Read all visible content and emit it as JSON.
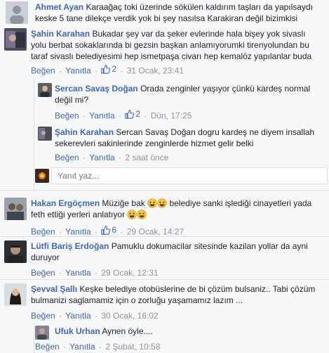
{
  "comments": [
    {
      "name": "Ahmet Ayan",
      "text": "Karaağaç toki üzerinde sökülen kaldırım taşları da yapılsaydı keske 5 tane dilekçe verdik yok bi şey nasılsa Karakiran değil bizimkisi"
    },
    {
      "name": "Şahin Karahan",
      "text": "Bukadar şey var da şeker evlerinde hala bişey yok sivaslı yolu berbat sokaklarında bi gezsin başkan anlamıyorumki tirenyolundan bu taraf sivaslı belediyesimi hep ismetpaşa civarı hep kemalöz yapılanlar buda",
      "like": "Beğen",
      "reply": "Yanıtla",
      "likes": "2",
      "time": "31 Ocak, 23:41"
    },
    {
      "name": "Sercan Savaş Doğan",
      "text": "Orada zenginler yaşıyor çünkü kardeş normal değil mi?",
      "like": "Beğen",
      "reply": "Yanıtla",
      "likes": "2",
      "time": "Dün, 17:25"
    },
    {
      "name": "Şahin Karahan",
      "mention": "Sercan Savaş Doğan",
      "text": "dogru kardeş ne diyem insallah sekerevleri sakinlerinde zenginlerde hizmet gelir belki",
      "like": "Beğen",
      "reply": "Yanıtla",
      "time": "2 saat önce"
    },
    {
      "name": "Hakan Ergöçmen",
      "text_a": "Müziğe bak",
      "text_b": "belediye sanki işlediği cinayetleri yada feth ettiği yerleri anlatıyor",
      "like": "Beğen",
      "reply": "Yanıtla",
      "likes": "6",
      "time": "29 Ocak, 14:27"
    },
    {
      "name": "Lütfi Bariş Erdoğan",
      "text": "Pamuklu dokumacilar sitesinde kazilan yollar da ayni duruyor",
      "like": "Beğen",
      "reply": "Yanıtla",
      "time": "29 Ocak, 12:31"
    },
    {
      "name": "Şevval Şallı",
      "text": "Keşke belediye otobüslerine de bi çözüm bulsaniz.. Tabi çözüm bulmanizi saglamamiz için o zorluğu yaşamamız lazım ...",
      "like": "Beğen",
      "reply": "Yanıtla",
      "time": "30 Ocak, 16:02"
    },
    {
      "name": "Ufuk Urhan",
      "text": "Aynen öyle....",
      "like": "Beğen",
      "reply": "Yanıtla",
      "time": "2 Şubat, 10:58"
    }
  ],
  "reply_input": {
    "placeholder": "Yanıt yaz..."
  },
  "sep": "·",
  "colors": {
    "link": "#4267b2",
    "meta": "#90949c",
    "bg": "#f6f7f9"
  },
  "icons": {
    "like": "thumbs-up-icon",
    "emoji": "grinning-squint-emoji"
  }
}
